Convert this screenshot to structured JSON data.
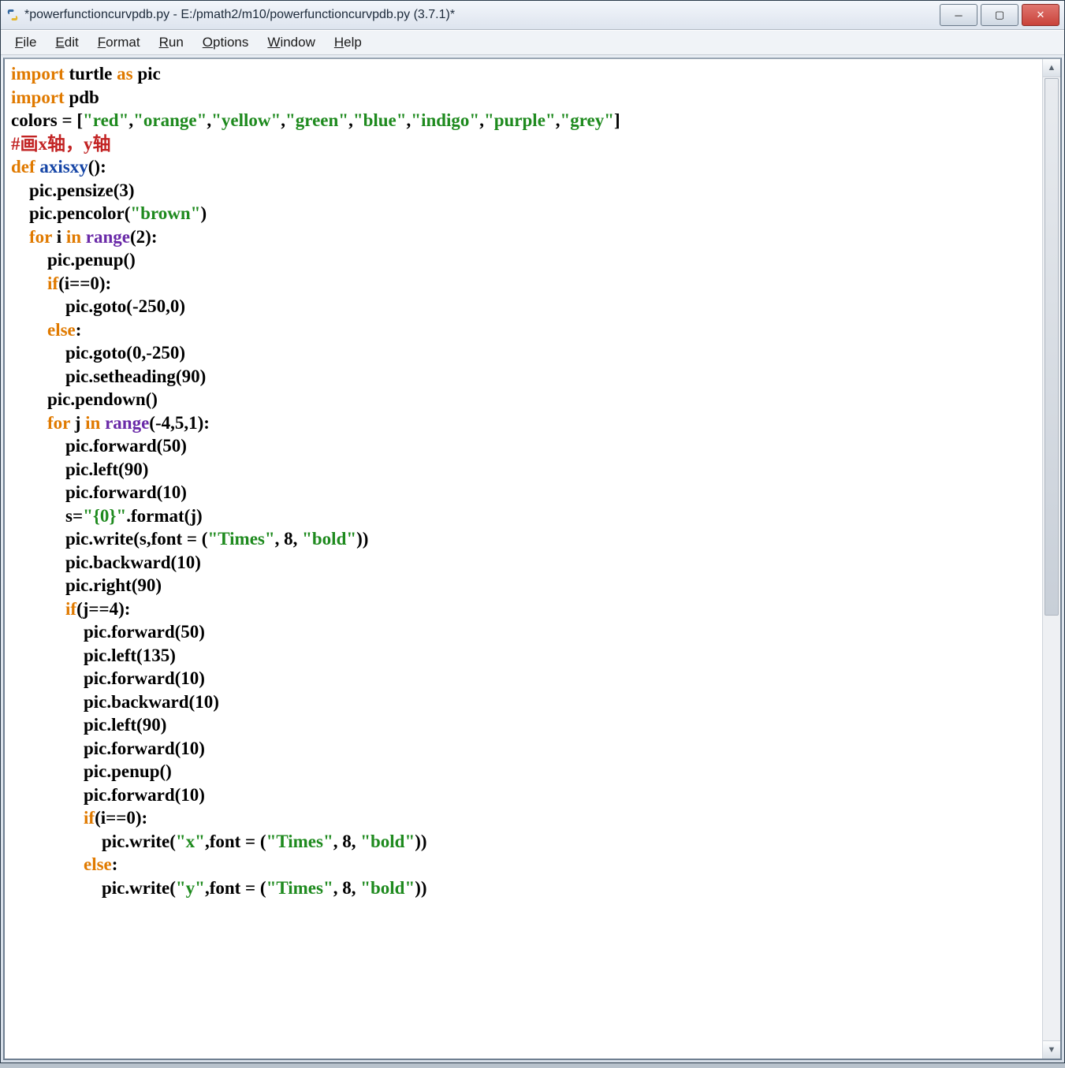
{
  "window": {
    "title": "*powerfunctioncurvpdb.py - E:/pmath2/m10/powerfunctioncurvpdb.py (3.7.1)*"
  },
  "menubar": {
    "items": [
      "File",
      "Edit",
      "Format",
      "Run",
      "Options",
      "Window",
      "Help"
    ]
  },
  "code": {
    "tokens": [
      [
        [
          "kw",
          "import"
        ],
        [
          "nm",
          " turtle "
        ],
        [
          "kw",
          "as"
        ],
        [
          "nm",
          " pic"
        ]
      ],
      [
        [
          "kw",
          "import"
        ],
        [
          "nm",
          " pdb"
        ]
      ],
      [
        [
          "nm",
          "colors = ["
        ],
        [
          "st",
          "\"red\""
        ],
        [
          "nm",
          ","
        ],
        [
          "st",
          "\"orange\""
        ],
        [
          "nm",
          ","
        ],
        [
          "st",
          "\"yellow\""
        ],
        [
          "nm",
          ","
        ],
        [
          "st",
          "\"green\""
        ],
        [
          "nm",
          ","
        ],
        [
          "st",
          "\"blue\""
        ],
        [
          "nm",
          ","
        ],
        [
          "st",
          "\"indigo\""
        ],
        [
          "nm",
          ","
        ],
        [
          "st",
          "\"purple\""
        ],
        [
          "nm",
          ","
        ],
        [
          "st",
          "\"grey\""
        ],
        [
          "nm",
          "]"
        ]
      ],
      [
        [
          "cm",
          "#画x轴，y轴"
        ]
      ],
      [
        [
          "kw",
          "def"
        ],
        [
          "nm",
          " "
        ],
        [
          "df",
          "axisxy"
        ],
        [
          "nm",
          "():"
        ]
      ],
      [
        [
          "nm",
          "    pic.pensize(3)"
        ]
      ],
      [
        [
          "nm",
          "    pic.pencolor("
        ],
        [
          "st",
          "\"brown\""
        ],
        [
          "nm",
          ")"
        ]
      ],
      [
        [
          "nm",
          "    "
        ],
        [
          "kw",
          "for"
        ],
        [
          "nm",
          " i "
        ],
        [
          "kw",
          "in"
        ],
        [
          "nm",
          " "
        ],
        [
          "bi",
          "range"
        ],
        [
          "nm",
          "(2):"
        ]
      ],
      [
        [
          "nm",
          "        pic.penup()"
        ]
      ],
      [
        [
          "nm",
          "        "
        ],
        [
          "kw",
          "if"
        ],
        [
          "nm",
          "(i==0):"
        ]
      ],
      [
        [
          "nm",
          "            pic.goto(-250,0)"
        ]
      ],
      [
        [
          "nm",
          "        "
        ],
        [
          "kw",
          "else"
        ],
        [
          "nm",
          ":"
        ]
      ],
      [
        [
          "nm",
          "            pic.goto(0,-250)"
        ]
      ],
      [
        [
          "nm",
          "            pic.setheading(90)"
        ]
      ],
      [
        [
          "nm",
          "        pic.pendown()"
        ]
      ],
      [
        [
          "nm",
          "        "
        ],
        [
          "kw",
          "for"
        ],
        [
          "nm",
          " j "
        ],
        [
          "kw",
          "in"
        ],
        [
          "nm",
          " "
        ],
        [
          "bi",
          "range"
        ],
        [
          "nm",
          "(-4,5,1):"
        ]
      ],
      [
        [
          "nm",
          "            pic.forward(50)"
        ]
      ],
      [
        [
          "nm",
          "            pic.left(90)"
        ]
      ],
      [
        [
          "nm",
          "            pic.forward(10)"
        ]
      ],
      [
        [
          "nm",
          "            s="
        ],
        [
          "st",
          "\"{0}\""
        ],
        [
          "nm",
          ".format(j)"
        ]
      ],
      [
        [
          "nm",
          "            pic.write(s,font = ("
        ],
        [
          "st",
          "\"Times\""
        ],
        [
          "nm",
          ", 8, "
        ],
        [
          "st",
          "\"bold\""
        ],
        [
          "nm",
          "))"
        ]
      ],
      [
        [
          "nm",
          "            pic.backward(10)"
        ]
      ],
      [
        [
          "nm",
          "            pic.right(90)"
        ]
      ],
      [
        [
          "nm",
          "            "
        ],
        [
          "kw",
          "if"
        ],
        [
          "nm",
          "(j==4):"
        ]
      ],
      [
        [
          "nm",
          "                pic.forward(50)"
        ]
      ],
      [
        [
          "nm",
          "                pic.left(135)"
        ]
      ],
      [
        [
          "nm",
          "                pic.forward(10)"
        ]
      ],
      [
        [
          "nm",
          "                pic.backward(10)"
        ]
      ],
      [
        [
          "nm",
          "                pic.left(90)"
        ]
      ],
      [
        [
          "nm",
          "                pic.forward(10)"
        ]
      ],
      [
        [
          "nm",
          "                pic.penup()"
        ]
      ],
      [
        [
          "nm",
          "                pic.forward(10)"
        ]
      ],
      [
        [
          "nm",
          "                "
        ],
        [
          "kw",
          "if"
        ],
        [
          "nm",
          "(i==0):"
        ]
      ],
      [
        [
          "nm",
          "                    pic.write("
        ],
        [
          "st",
          "\"x\""
        ],
        [
          "nm",
          ",font = ("
        ],
        [
          "st",
          "\"Times\""
        ],
        [
          "nm",
          ", 8, "
        ],
        [
          "st",
          "\"bold\""
        ],
        [
          "nm",
          "))"
        ]
      ],
      [
        [
          "nm",
          "                "
        ],
        [
          "kw",
          "else"
        ],
        [
          "nm",
          ":"
        ]
      ],
      [
        [
          "nm",
          "                    pic.write("
        ],
        [
          "st",
          "\"y\""
        ],
        [
          "nm",
          ",font = ("
        ],
        [
          "st",
          "\"Times\""
        ],
        [
          "nm",
          ", 8, "
        ],
        [
          "st",
          "\"bold\""
        ],
        [
          "nm",
          "))"
        ]
      ]
    ]
  },
  "controls": {
    "minimize": "─",
    "maximize": "▢",
    "close": "✕"
  }
}
